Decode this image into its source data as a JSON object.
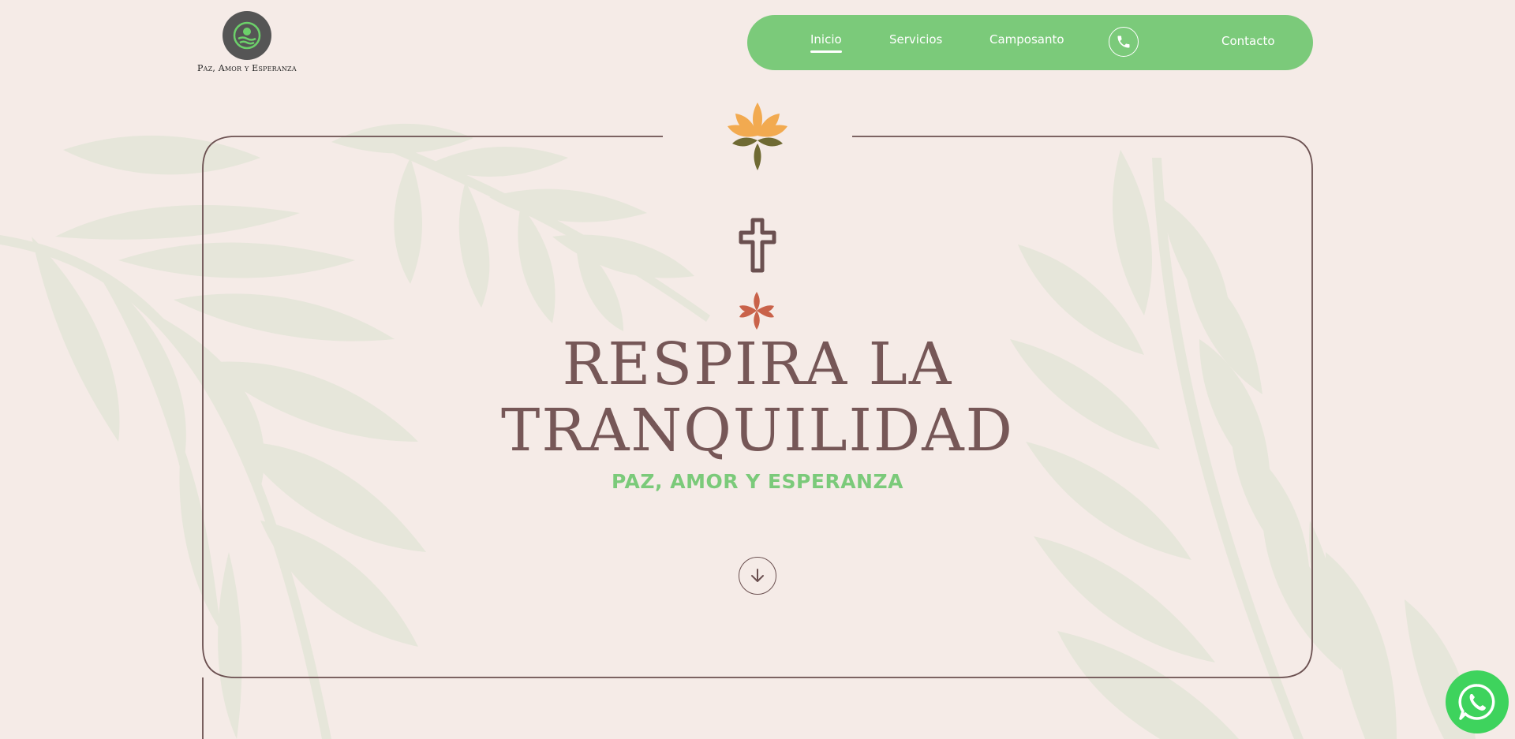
{
  "brand": {
    "name": "Paz, Amor y Esperanza",
    "logo_icon": "person-waves-logo-icon"
  },
  "nav": {
    "items": [
      {
        "label": "Inicio",
        "active": true
      },
      {
        "label": "Servicios",
        "active": false
      },
      {
        "label": "Camposanto",
        "active": false
      }
    ],
    "phone_icon": "phone-icon",
    "contact_label": "Contacto"
  },
  "hero": {
    "title_line1": "RESPIRA LA",
    "title_line2": "TRANQUILIDAD",
    "subtitle": "PAZ, AMOR Y ESPERANZA",
    "scroll_icon": "arrow-down-icon",
    "decor_icons": [
      "lotus-icon",
      "cross-icon",
      "flower-icon"
    ]
  },
  "floating": {
    "whatsapp_icon": "whatsapp-icon"
  },
  "colors": {
    "background": "#f5ebe7",
    "nav_green": "#7bca7a",
    "title_brown": "#765757",
    "accent_green": "#7bca7a",
    "leaf": "#e6e6da",
    "whatsapp": "#3ed35d"
  }
}
